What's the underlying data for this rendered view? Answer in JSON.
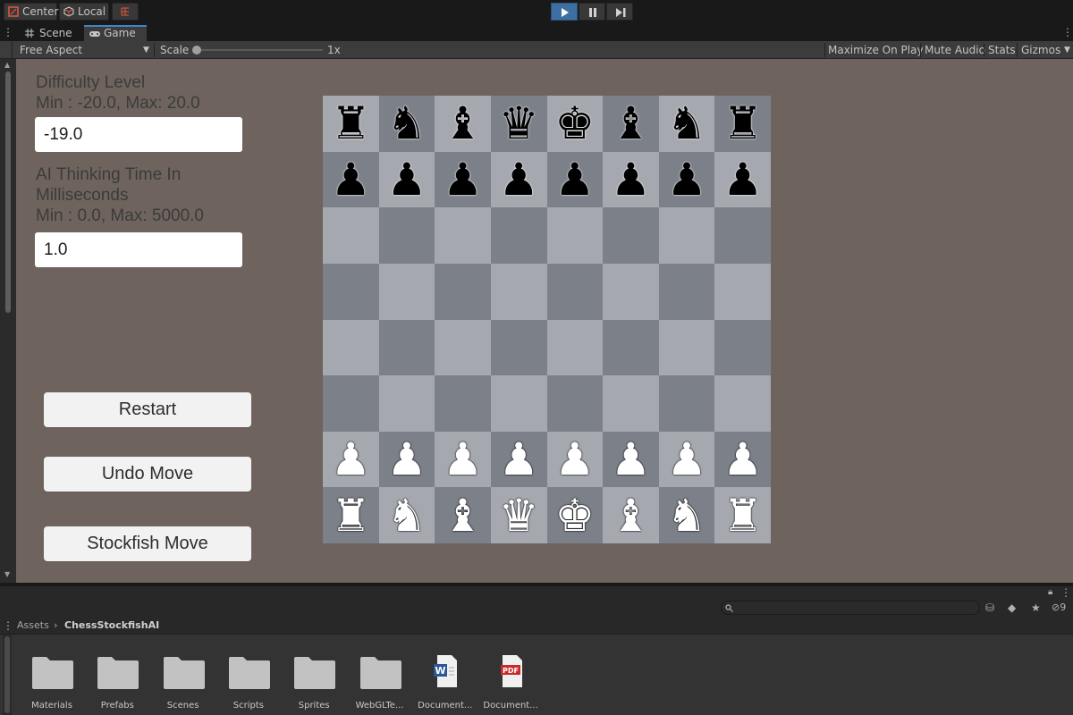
{
  "toolbar": {
    "center_label": "Center",
    "local_label": "Local"
  },
  "tabs": [
    {
      "label": "Scene",
      "icon": "grid-icon"
    },
    {
      "label": "Game",
      "icon": "gamepad-icon"
    }
  ],
  "game_toolbar": {
    "aspect": "Free Aspect",
    "scale_label": "Scale",
    "scale_value": "1x",
    "maximize": "Maximize On Play",
    "mute": "Mute Audio",
    "stats": "Stats",
    "gizmos": "Gizmos"
  },
  "game_ui": {
    "difficulty_title": "Difficulty Level",
    "difficulty_range": "Min : -20.0, Max: 20.0",
    "difficulty_value": "-19.0",
    "thinking_title_1": "AI Thinking Time In",
    "thinking_title_2": "Milliseconds",
    "thinking_range": "Min : 0.0, Max: 5000.0",
    "thinking_value": "1.0",
    "restart": "Restart",
    "undo": "Undo Move",
    "stockfish": "Stockfish Move"
  },
  "board": {
    "rows": [
      [
        "br",
        "bn",
        "bb",
        "bq",
        "bk",
        "bb",
        "bn",
        "br"
      ],
      [
        "bp",
        "bp",
        "bp",
        "bp",
        "bp",
        "bp",
        "bp",
        "bp"
      ],
      [
        "",
        "",
        "",
        "",
        "",
        "",
        "",
        ""
      ],
      [
        "",
        "",
        "",
        "",
        "",
        "",
        "",
        ""
      ],
      [
        "",
        "",
        "",
        "",
        "",
        "",
        "",
        ""
      ],
      [
        "",
        "",
        "",
        "",
        "",
        "",
        "",
        ""
      ],
      [
        "wp",
        "wp",
        "wp",
        "wp",
        "wp",
        "wp",
        "wp",
        "wp"
      ],
      [
        "wr",
        "wn",
        "wb",
        "wq",
        "wk",
        "wb",
        "wn",
        "wr"
      ]
    ]
  },
  "project": {
    "breadcrumb_root": "Assets",
    "breadcrumb_current": "ChessStockfishAI",
    "hidden_count": "9",
    "assets": [
      {
        "name": "Materials",
        "kind": "folder"
      },
      {
        "name": "Prefabs",
        "kind": "folder"
      },
      {
        "name": "Scenes",
        "kind": "folder"
      },
      {
        "name": "Scripts",
        "kind": "folder"
      },
      {
        "name": "Sprites",
        "kind": "folder"
      },
      {
        "name": "WebGLTe...",
        "kind": "folder"
      },
      {
        "name": "Document...",
        "kind": "word-doc"
      },
      {
        "name": "Document...",
        "kind": "pdf-doc"
      }
    ],
    "pdf_badge": "PDF",
    "word_badge": "W"
  }
}
